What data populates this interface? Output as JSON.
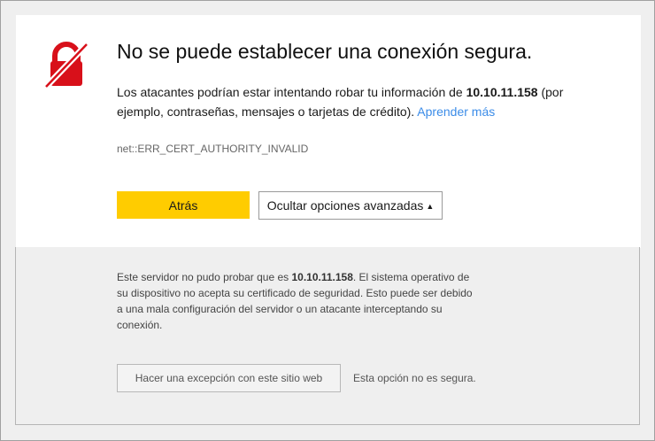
{
  "error": {
    "title": "No se puede establecer una conexión segura.",
    "description_prefix": "Los atacantes podrían estar intentando robar tu información de ",
    "host": "10.10.11.158",
    "description_suffix": " (por ejemplo, contraseñas, mensajes o tarjetas de crédito). ",
    "learn_more": "Aprender más",
    "code": "net::ERR_CERT_AUTHORITY_INVALID"
  },
  "buttons": {
    "back": "Atrás",
    "hide_advanced": "Ocultar opciones avanzadas",
    "hide_advanced_caret": "▲"
  },
  "advanced": {
    "text_prefix": "Este servidor no pudo probar que es ",
    "host": "10.10.11.158",
    "text_suffix": ". El sistema operativo de su dispositivo no acepta su certificado de seguridad. Esto puede ser debido a una mala configuración del servidor o un atacante interceptando su conexión.",
    "exception_button": "Hacer una excepción con este sitio web",
    "unsafe_note": "Esta opción no es segura."
  },
  "icons": {
    "lock": "broken-lock-icon"
  },
  "colors": {
    "accent_yellow": "#ffcc00",
    "lock_red": "#d8101a",
    "link_blue": "#3b8ce8"
  }
}
